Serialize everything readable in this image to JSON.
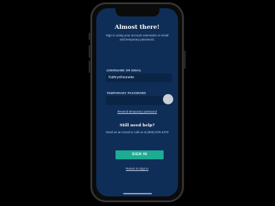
{
  "login": {
    "title": "Almost there!",
    "subtitle": "Sign in using your account username or email and temporary password.",
    "username_label": "USERNAME OR EMAIL",
    "username_value": "KathrynKeuneke",
    "password_label": "TEMPORARY PASSWORD",
    "resend_link": "Resend temporary password",
    "help_title": "Still need help?",
    "help_text": "Send us an email or call us at (800) 879-4378",
    "signin_button": "SIGN IN",
    "return_link": "Return to sign in"
  },
  "colors": {
    "screen_bg": "#0f2e57",
    "field_bg": "#0a2446",
    "accent": "#1cab93"
  }
}
